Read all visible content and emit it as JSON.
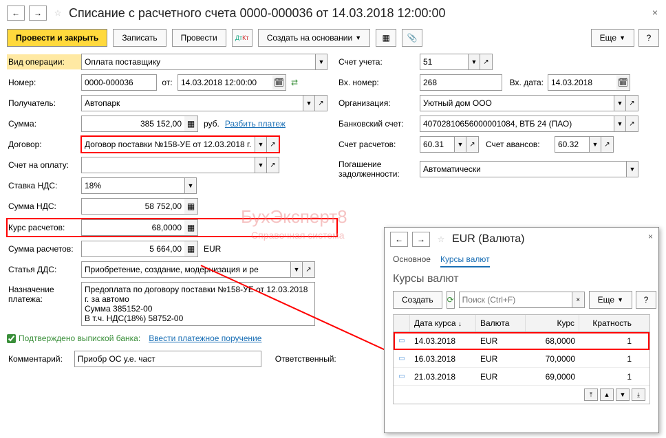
{
  "title": "Списание с расчетного счета 0000-000036 от 14.03.2018 12:00:00",
  "toolbar": {
    "submit_close": "Провести и закрыть",
    "save": "Записать",
    "submit": "Провести",
    "create_based": "Создать на основании",
    "more": "Еще"
  },
  "labels": {
    "op_type": "Вид операции:",
    "number": "Номер:",
    "from": "от:",
    "recipient": "Получатель:",
    "sum": "Сумма:",
    "rub": "руб.",
    "split": "Разбить платеж",
    "contract": "Договор:",
    "invoice": "Счет на оплату:",
    "vat_rate": "Ставка НДС:",
    "vat_sum": "Сумма НДС:",
    "rate": "Курс расчетов:",
    "calc_sum": "Сумма расчетов:",
    "eur": "EUR",
    "dds": "Статья ДДС:",
    "purpose": "Назначение платежа:",
    "confirmed": "Подтверждено выпиской банка:",
    "enter_payment": "Ввести платежное поручение",
    "comment": "Комментарий:",
    "responsible": "Ответственный:",
    "account": "Счет учета:",
    "in_number": "Вх. номер:",
    "in_date": "Вх. дата:",
    "org": "Организация:",
    "bank_acc": "Банковский счет:",
    "calc_acc": "Счет расчетов:",
    "advance_acc": "Счет авансов:",
    "debt": "Погашение задолженности:"
  },
  "values": {
    "op_type": "Оплата поставщику",
    "number": "0000-000036",
    "date": "14.03.2018 12:00:00",
    "recipient": "Автопарк",
    "sum": "385 152,00",
    "contract": "Договор поставки №158-УЕ от 12.03.2018 г.",
    "vat_rate": "18%",
    "vat_sum": "58 752,00",
    "rate": "68,0000",
    "calc_sum": "5 664,00",
    "dds": "Приобретение, создание, модернизация и ре",
    "purpose": "Предоплата по договору поставки №158-УЕ от 12.03.2018 г. за автомо\nСумма 385152-00\nВ т.ч. НДС(18%) 58752-00",
    "comment": "Приобр ОС у.е. част",
    "account": "51",
    "in_number": "268",
    "in_date": "14.03.2018",
    "org": "Уютный дом ООО",
    "bank_acc": "40702810656000001084, ВТБ 24 (ПАО)",
    "calc_acc": "60.31",
    "advance_acc": "60.32",
    "debt": "Автоматически"
  },
  "popup": {
    "title": "EUR (Валюта)",
    "tab_main": "Основное",
    "tab_rates": "Курсы валют",
    "subtitle": "Курсы валют",
    "create": "Создать",
    "search_ph": "Поиск (Ctrl+F)",
    "more": "Еще",
    "cols": {
      "date": "Дата курса",
      "currency": "Валюта",
      "rate": "Курс",
      "mult": "Кратность"
    },
    "rows": [
      {
        "date": "14.03.2018",
        "currency": "EUR",
        "rate": "68,0000",
        "mult": "1"
      },
      {
        "date": "16.03.2018",
        "currency": "EUR",
        "rate": "70,0000",
        "mult": "1"
      },
      {
        "date": "21.03.2018",
        "currency": "EUR",
        "rate": "69,0000",
        "mult": "1"
      }
    ]
  }
}
